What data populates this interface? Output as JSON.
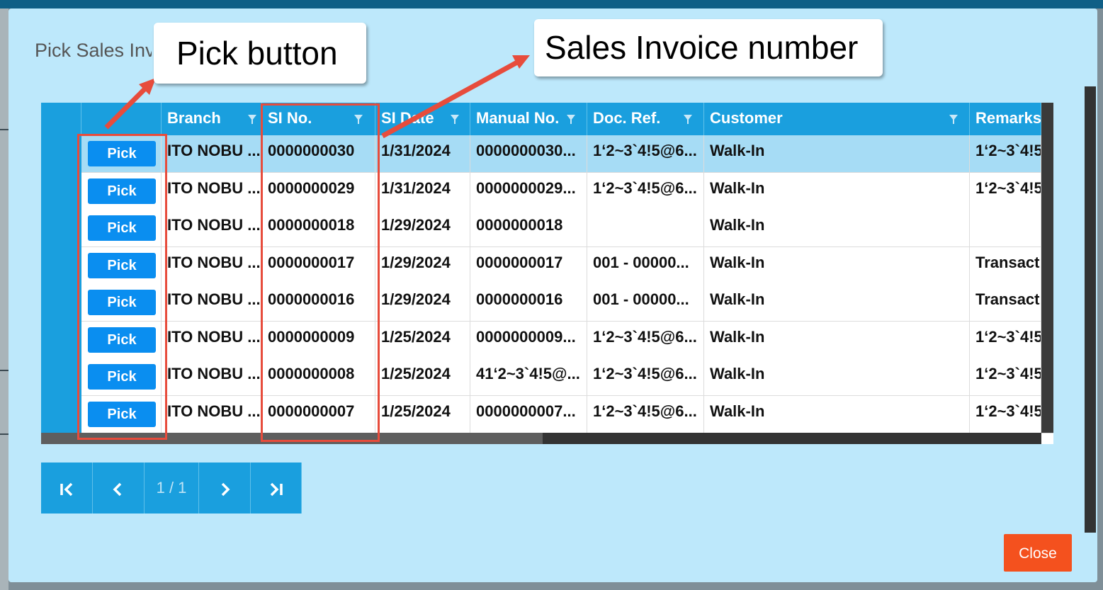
{
  "modal": {
    "title": "Pick Sales Invoice"
  },
  "grid": {
    "columns": [
      {
        "label": ""
      },
      {
        "label": "Branch"
      },
      {
        "label": "SI No."
      },
      {
        "label": "SI Date"
      },
      {
        "label": "Manual No."
      },
      {
        "label": "Doc. Ref."
      },
      {
        "label": "Customer"
      },
      {
        "label": "Remarks"
      }
    ],
    "pick_label": "Pick",
    "rows": [
      {
        "branch": "ITO NOBU ...",
        "si_no": "0000000030",
        "si_date": "1/31/2024",
        "manual_no": "0000000030...",
        "doc_ref": "1‘2~3`4!5@6...",
        "customer": "Walk-In",
        "remarks": "1‘2~3`4!5"
      },
      {
        "branch": "ITO NOBU ...",
        "si_no": "0000000029",
        "si_date": "1/31/2024",
        "manual_no": "0000000029...",
        "doc_ref": "1‘2~3`4!5@6...",
        "customer": "Walk-In",
        "remarks": "1‘2~3`4!5"
      },
      {
        "branch": "ITO NOBU ...",
        "si_no": "0000000018",
        "si_date": "1/29/2024",
        "manual_no": "0000000018",
        "doc_ref": "",
        "customer": "Walk-In",
        "remarks": ""
      },
      {
        "branch": "ITO NOBU ...",
        "si_no": "0000000017",
        "si_date": "1/29/2024",
        "manual_no": "0000000017",
        "doc_ref": "001 - 00000...",
        "customer": "Walk-In",
        "remarks": "Transacti"
      },
      {
        "branch": "ITO NOBU ...",
        "si_no": "0000000016",
        "si_date": "1/29/2024",
        "manual_no": "0000000016",
        "doc_ref": "001 - 00000...",
        "customer": "Walk-In",
        "remarks": "Transacti"
      },
      {
        "branch": "ITO NOBU ...",
        "si_no": "0000000009",
        "si_date": "1/25/2024",
        "manual_no": "0000000009...",
        "doc_ref": "1‘2~3`4!5@6...",
        "customer": "Walk-In",
        "remarks": "1‘2~3`4!5"
      },
      {
        "branch": "ITO NOBU ...",
        "si_no": "0000000008",
        "si_date": "1/25/2024",
        "manual_no": "41‘2~3`4!5@...",
        "doc_ref": "1‘2~3`4!5@6...",
        "customer": "Walk-In",
        "remarks": "1‘2~3`4!5"
      },
      {
        "branch": "ITO NOBU ...",
        "si_no": "0000000007",
        "si_date": "1/25/2024",
        "manual_no": "0000000007...",
        "doc_ref": "1‘2~3`4!5@6...",
        "customer": "Walk-In",
        "remarks": "1‘2~3`4!5"
      }
    ]
  },
  "pager": {
    "page_info": "1 / 1",
    "first_icon": "first-page-icon",
    "prev_icon": "prev-page-icon",
    "next_icon": "next-page-icon",
    "last_icon": "last-page-icon"
  },
  "close_label": "Close",
  "annotations": {
    "pick_callout": "Pick button",
    "si_callout": "Sales Invoice number"
  },
  "colors": {
    "header_blue": "#1a9fde",
    "modal_bg": "#bde8fb",
    "pick_button": "#0a8ef0",
    "close_button": "#f4511e",
    "highlight_red": "#e74c3c",
    "selected_row": "#a6dcf5"
  }
}
